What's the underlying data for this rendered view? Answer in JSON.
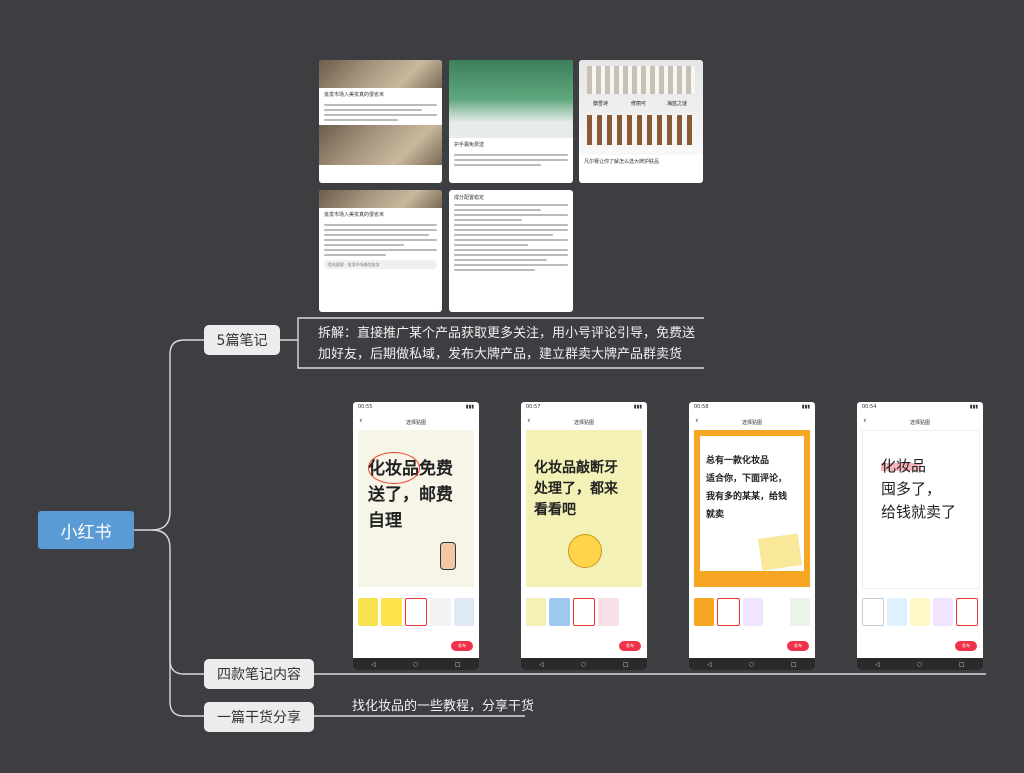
{
  "root": {
    "label": "小红书"
  },
  "branches": [
    {
      "label": "5篇笔记",
      "note": "拆解：直接推广某个产品获取更多关注，用小号评论引导，免费送加好友，后期做私域，发布大牌产品，建立群卖大牌产品群卖货"
    },
    {
      "label": "四款笔记内容"
    },
    {
      "label": "一篇干货分享",
      "note": "找化妆品的一些教程，分享干货"
    }
  ],
  "note_cards": [
    {
      "title": "批发市场入美妆真的很省米",
      "caption": ""
    },
    {
      "title": "护手霜免费送",
      "caption": ""
    },
    {
      "title": "凡尔赛让你了解怎么选大牌护肤品",
      "caption": "",
      "labels": [
        "旗雪诗",
        "修丽可",
        "海蓝之谜"
      ]
    },
    {
      "title": "批发市场入美妆真的很省米",
      "caption": "相关搜索 · 批发市场美妆批发"
    },
    {
      "title": "成分配置稳定",
      "caption": ""
    }
  ],
  "phones": [
    {
      "time": "00:55",
      "topbar": "选择贴图",
      "poster_text": [
        "化妆品免费",
        "送了，邮费",
        "自理"
      ],
      "poster_bg": "#f7f4e8",
      "cta": "发布"
    },
    {
      "time": "00:57",
      "topbar": "选择贴图",
      "poster_text": [
        "化妆品敲断牙",
        "处理了，都来",
        "看看吧"
      ],
      "poster_bg": "#f4f1b6",
      "cta": "发布"
    },
    {
      "time": "00:58",
      "topbar": "选择贴图",
      "poster_text": [
        "总有一款化妆品",
        "适合你，下面评论，",
        "我有多的某某，给钱",
        "就卖"
      ],
      "poster_bg": "#f7a623",
      "cta": "发布"
    },
    {
      "time": "00:54",
      "topbar": "选择贴图",
      "poster_text": [
        "化妆品",
        "囤多了，",
        "给钱就卖了"
      ],
      "poster_bg": "#ffffff",
      "cta": "发布"
    }
  ],
  "colors": {
    "background": "#3d3e42",
    "root": "#5b9bd5",
    "branch": "#ececec",
    "cta": "#f0334a"
  }
}
